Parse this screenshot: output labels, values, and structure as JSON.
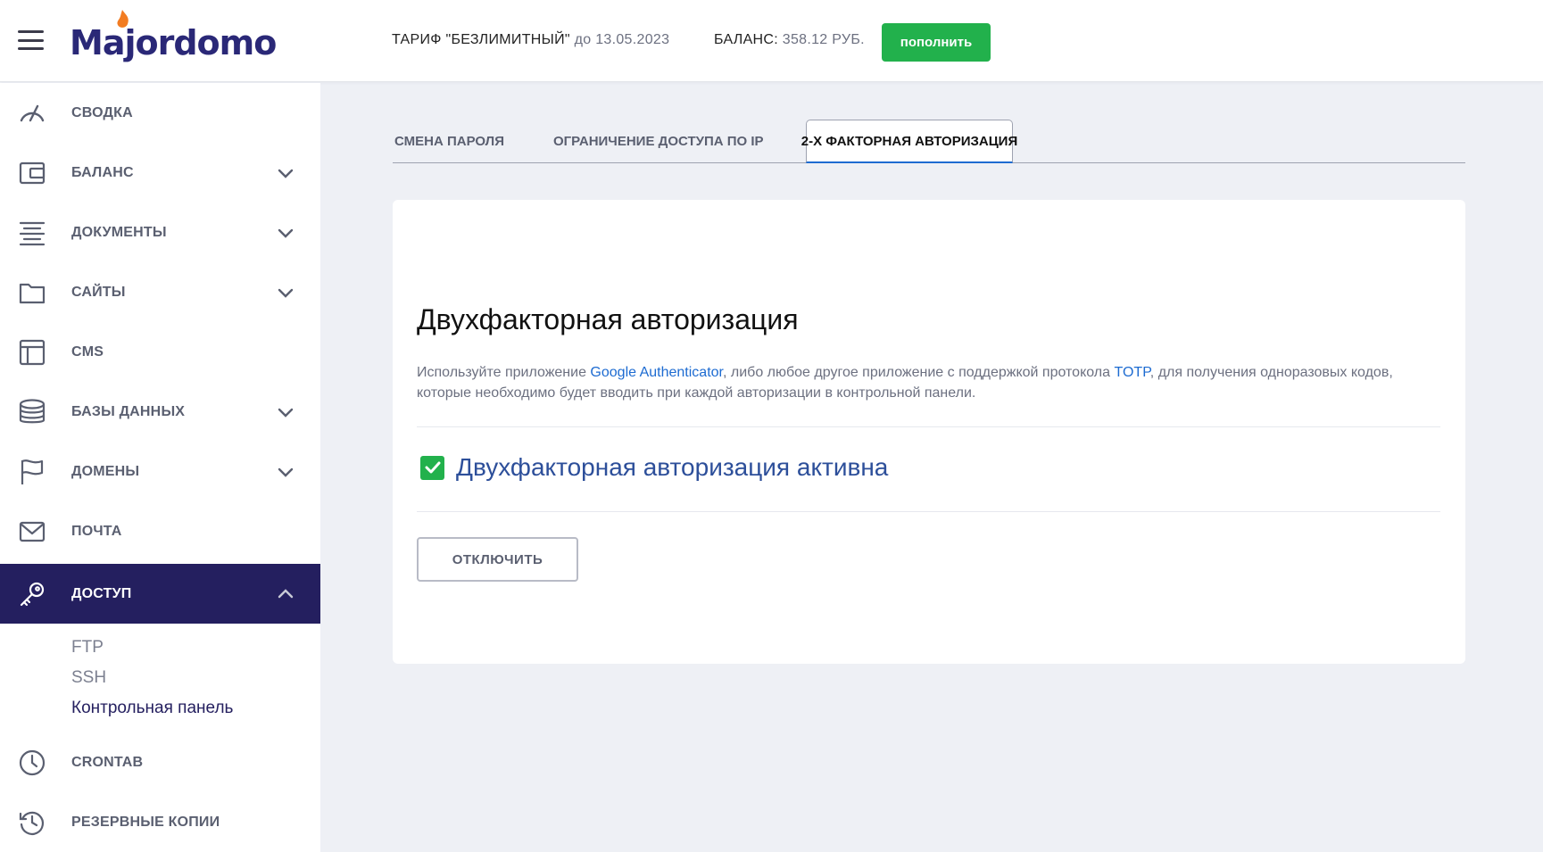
{
  "header": {
    "logo_text": "Majordomo",
    "tariff_label": "ТАРИФ \"БЕЗЛИМИТНЫЙ\"",
    "tariff_until": "до 13.05.2023",
    "balance_label": "БАЛАНС:",
    "balance_value": "358.12 РУБ.",
    "topup_label": "пополнить",
    "menu_icon": "hamburger-icon"
  },
  "sidebar": {
    "items": [
      {
        "label": "СВОДКА",
        "icon": "speedometer-icon"
      },
      {
        "label": "БАЛАНС",
        "icon": "wallet-icon"
      },
      {
        "label": "ДОКУМЕНТЫ",
        "icon": "document-lines-icon"
      },
      {
        "label": "САЙТЫ",
        "icon": "folder-icon"
      },
      {
        "label": "CMS",
        "icon": "layout-icon"
      },
      {
        "label": "БАЗЫ ДАННЫХ",
        "icon": "database-icon"
      },
      {
        "label": "ДОМЕНЫ",
        "icon": "flag-icon"
      },
      {
        "label": "ПОЧТА",
        "icon": "mail-icon"
      },
      {
        "label": "ДОСТУП",
        "icon": "key-icon"
      },
      {
        "label": "CRONTAB",
        "icon": "clock-icon"
      },
      {
        "label": "РЕЗЕРВНЫЕ КОПИИ",
        "icon": "history-icon"
      }
    ],
    "access_subitems": [
      "FTP",
      "SSH",
      "Контрольная панель"
    ]
  },
  "tabs": [
    {
      "label": "СМЕНА ПАРОЛЯ"
    },
    {
      "label": "ОГРАНИЧЕНИЕ ДОСТУПА ПО IP"
    },
    {
      "label": "2-Х ФАКТОРНАЯ АВТОРИЗАЦИЯ"
    }
  ],
  "card": {
    "title": "Двухфакторная авторизация",
    "desc_part1": "Используйте приложение ",
    "desc_link1": "Google Authenticator",
    "desc_part2": ", либо любое другое приложение с поддержкой протокола ",
    "desc_link2": "TOTP",
    "desc_part3": ", для получения одноразовых кодов, которые необходимо будет вводить при каждой авторизации в контрольной панели.",
    "checkbox_label": "Двухфакторная авторизация активна",
    "disable_button": "ОТКЛЮЧИТЬ"
  },
  "colors": {
    "brand_dark": "#241f5f",
    "accent_green": "#22b14c",
    "link_blue": "#1d6bd1",
    "flame_orange": "#f27c22"
  }
}
